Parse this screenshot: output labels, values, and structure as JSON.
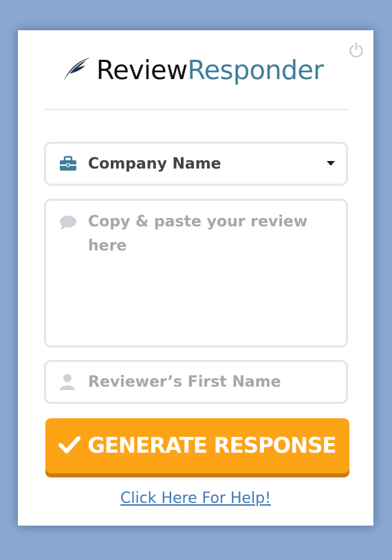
{
  "logo": {
    "part1": "Review",
    "part2": "Responder",
    "icon": "feather-icon"
  },
  "header": {
    "power_icon": "power-icon"
  },
  "form": {
    "company": {
      "value": "Company Name",
      "icon": "briefcase-icon"
    },
    "review": {
      "placeholder": "Copy & paste your review here",
      "icon": "speech-bubble-icon"
    },
    "first_name": {
      "placeholder": "Reviewer’s First Name",
      "icon": "user-icon"
    }
  },
  "actions": {
    "generate_label": "GENERATE RESPONSE",
    "help_label": "Click Here For Help!"
  },
  "colors": {
    "accent": "#fda316",
    "brand": "#3f7d9b",
    "link": "#3f79b6",
    "background": "#8aa8d2"
  }
}
